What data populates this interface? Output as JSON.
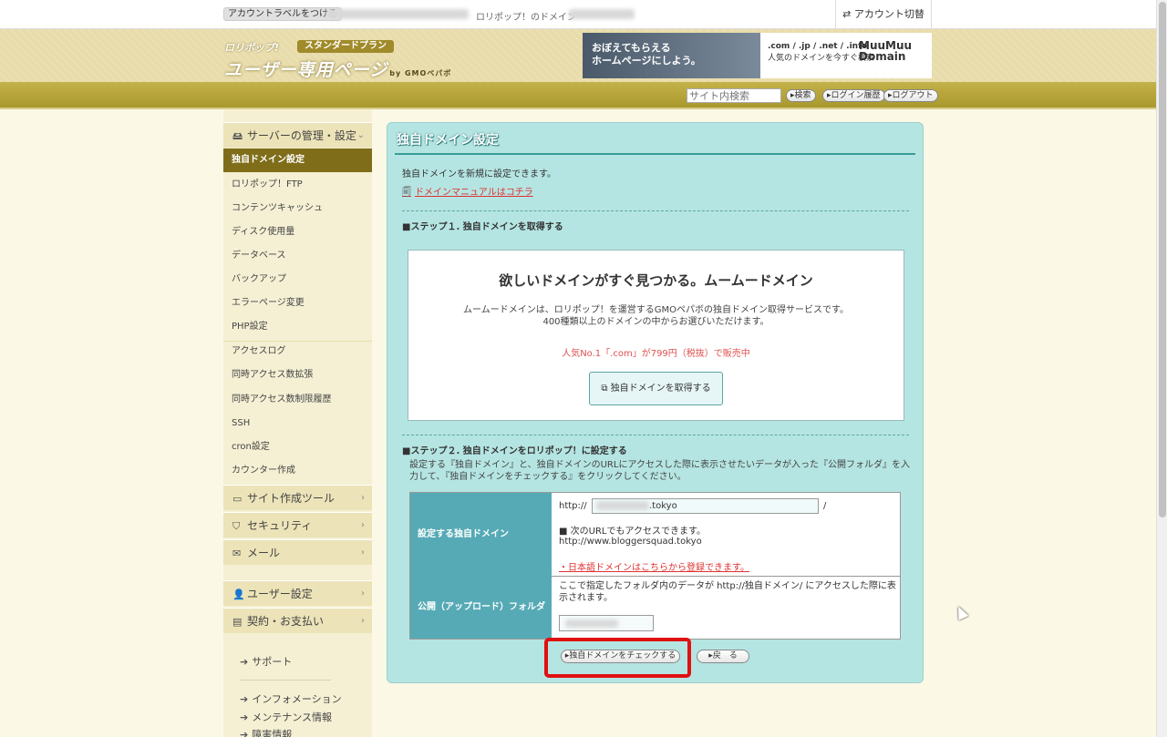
{
  "topbar": {
    "label_button": "アカウントラベルをつける",
    "domain_prefix": "ロリポップ！のドメイン",
    "switch_label": "アカウント切替"
  },
  "header": {
    "logo": "ロリポップ!",
    "plan": "スタンダードプラン",
    "title": "ユーザー専用ページ",
    "by": "by GMOペパボ",
    "banner_left": "おぼえてもらえる\nホームページにしよう。",
    "banner_tlds": ".com / .jp / .net / .info",
    "banner_sub": "人気のドメインを今すぐ検索",
    "banner_logo": "MuuMuu Domain"
  },
  "nav": {
    "search_placeholder": "サイト内検索",
    "search_btn": "検索",
    "history_btn": "ログイン履歴",
    "logout_btn": "ログアウト"
  },
  "sidebar": {
    "server_group": "サーバーの管理・設定",
    "items": [
      "独自ドメイン設定",
      "ロリポップ！FTP",
      "コンテンツキャッシュ",
      "ディスク使用量",
      "データベース",
      "バックアップ",
      "エラーページ変更",
      "PHP設定",
      "アクセスログ",
      "同時アクセス数拡張",
      "同時アクセス数制限履歴",
      "SSH",
      "cron設定",
      "カウンター作成"
    ],
    "site_tools": "サイト作成ツール",
    "security": "セキュリティ",
    "mail": "メール",
    "user_settings": "ユーザー設定",
    "billing": "契約・お支払い",
    "support": "サポート",
    "info": "インフォメーション",
    "maintenance": "メンテナンス情報",
    "outage": "障害情報"
  },
  "main": {
    "title": "独自ドメイン設定",
    "intro": "独自ドメインを新規に設定できます。",
    "manual_link": "ドメインマニュアルはコチラ",
    "step1": "■ステップ１. 独自ドメインを取得する",
    "promo_heading": "欲しいドメインがすぐ見つかる。ムームードメイン",
    "promo_line1": "ムームードメインは、ロリポップ！を運営するGMOペパボの独自ドメイン取得サービスです。",
    "promo_line2": "400種類以上のドメインの中からお選びいただけます。",
    "promo_price": "人気No.1「.com」が799円（税抜）で販売中",
    "promo_button": "独自ドメインを取得する",
    "step2": "■ステップ２. 独自ドメインをロリポップ！に設定する",
    "step2_desc": "設定する『独自ドメイン』と、独自ドメインのURLにアクセスした際に表示させたいデータが入った『公開フォルダ』を入力して、『独自ドメインをチェックする』をクリックしてください。",
    "row1_label": "設定する独自ドメイン",
    "http_prefix": "http://",
    "domain_value": ".tokyo",
    "slash": "/",
    "also_access": "■ 次のURLでもアクセスできます。",
    "www_url": "http://www.bloggersquad.tokyo",
    "jp_domain_link": "・日本語ドメインはこちらから登録できます。",
    "row2_label": "公開（アップロード）フォルダ",
    "folder_desc": "ここで指定したフォルダ内のデータが http://独自ドメイン/ にアクセスした際に表示されます。",
    "check_button": "独自ドメインをチェックする",
    "back_button": "戻　る"
  },
  "colors": {
    "panel_bg": "#b5e5e2",
    "table_header": "#56aab5",
    "active_nav": "#7f6d1a",
    "highlight": "#e01010"
  }
}
